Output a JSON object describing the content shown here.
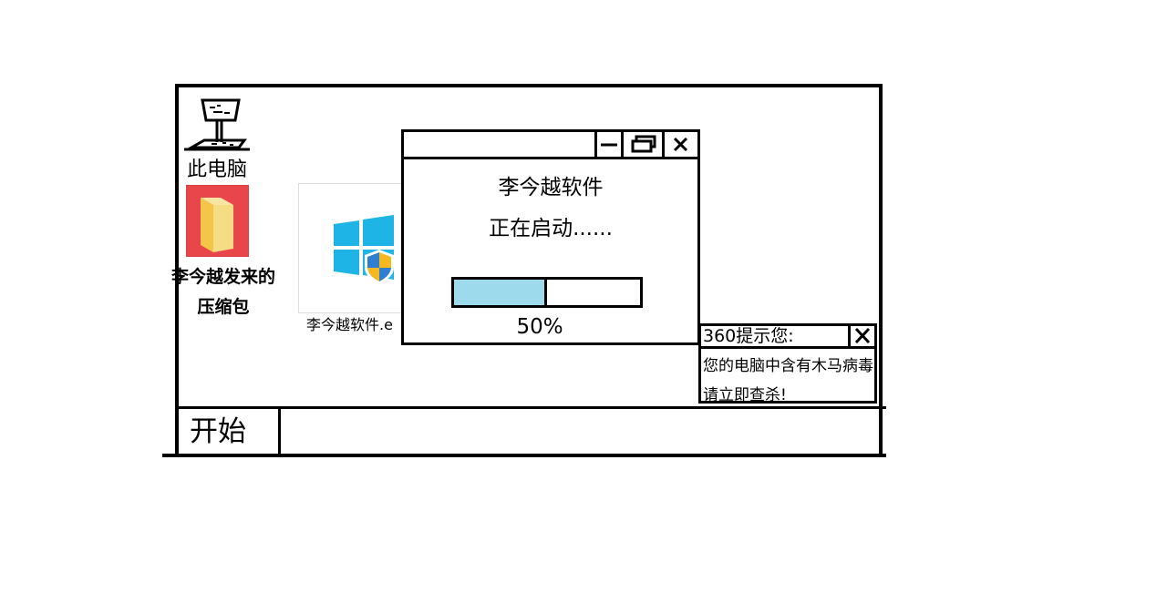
{
  "desktop": {
    "icons": [
      {
        "label": "此电脑",
        "icon": "computer-sketch-icon"
      },
      {
        "label_line1": "李今越发来的",
        "label_line2": "压缩包",
        "icon": "folder-icon",
        "tile_color": "#e8464b"
      },
      {
        "label": "李今越软件.e",
        "icon": "windows-shield-icon"
      }
    ]
  },
  "dialog": {
    "title": "李今越软件",
    "status": "正在启动......",
    "progress_fraction": 0.5,
    "progress_text": "50%",
    "progress_color": "#9ddbec",
    "buttons": {
      "minimize": "minimize-icon",
      "maximize": "restore-icon",
      "close": "close-icon"
    }
  },
  "popup": {
    "title": "360提示您:",
    "message_line1": "您的电脑中含有木马病毒",
    "message_line2": "请立即查杀!"
  },
  "taskbar": {
    "start_label": "开始"
  }
}
